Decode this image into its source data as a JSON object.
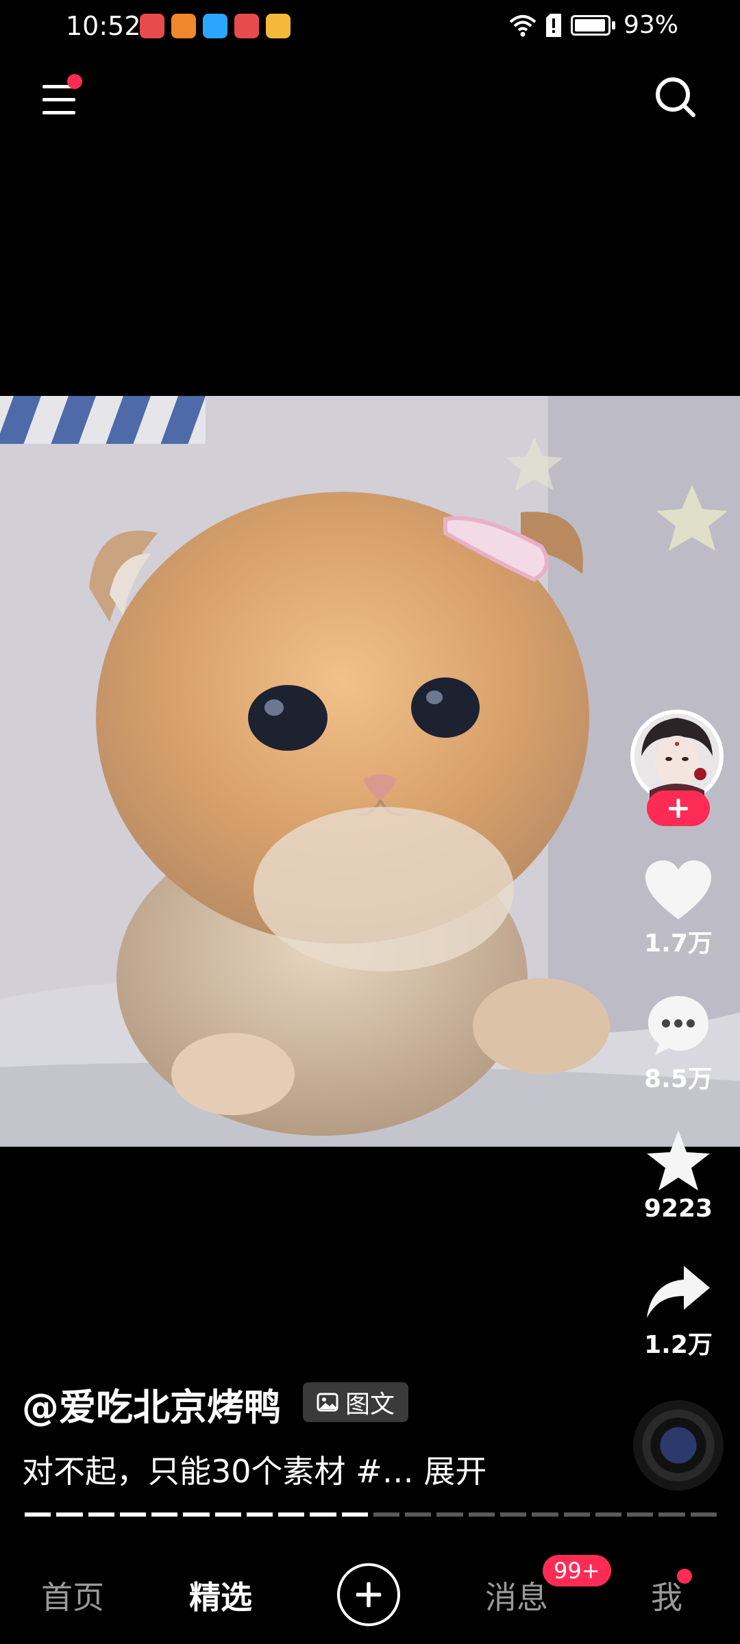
{
  "status_bar": {
    "time": "10:52",
    "battery": "93%",
    "notification_apps": [
      {
        "icon": "huawei-store-icon",
        "color": "#e84b4b"
      },
      {
        "icon": "game-center-icon",
        "color": "#f0872b"
      },
      {
        "icon": "browser-search-icon",
        "color": "#2aa6ff"
      },
      {
        "icon": "huawei-store-icon",
        "color": "#e84b4b"
      },
      {
        "icon": "notes-app-icon",
        "color": "#f5b93a"
      }
    ]
  },
  "header": {
    "menu_icon": "menu-icon",
    "search_icon": "search-icon"
  },
  "post": {
    "author": "@爱吃北京烤鸭",
    "type_tag": "图文",
    "caption": "对不起，只能30个素材 #… ",
    "expand_label": "展开"
  },
  "actions": {
    "likes": "1.7万",
    "comments": "8.5万",
    "favorites": "9223",
    "shares": "1.2万"
  },
  "progress": {
    "segments_total": 22,
    "segments_viewed": 11
  },
  "bottom_nav": {
    "home": "首页",
    "featured": "精选",
    "messages": "消息",
    "messages_badge": "99+",
    "me": "我"
  },
  "colors": {
    "accent": "#fe2c55",
    "background": "#000000"
  }
}
